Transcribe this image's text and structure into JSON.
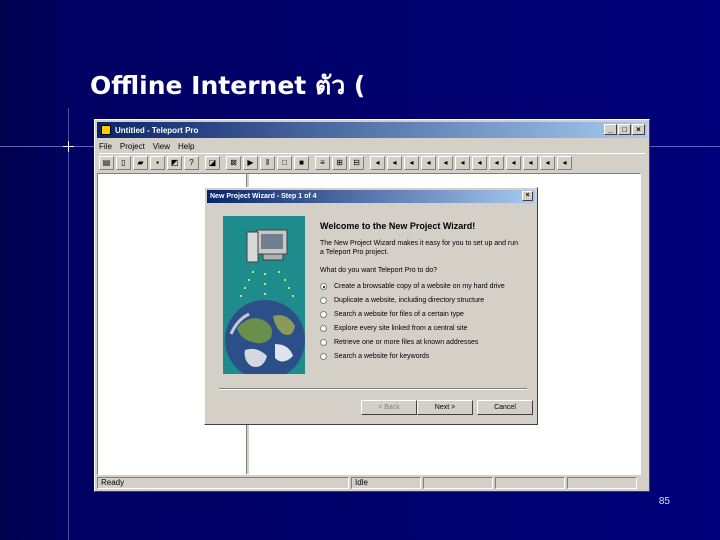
{
  "slide": {
    "title": "Offline Internet",
    "title_suffix": "ตัว (",
    "page_number": "85"
  },
  "app": {
    "title": "Untitled - Teleport Pro",
    "window_buttons": [
      "_",
      "□",
      "×"
    ],
    "menu": [
      "File",
      "Project",
      "View",
      "Help"
    ],
    "status_ready": "Ready",
    "status_idle": "Idle"
  },
  "wizard": {
    "title": "New Project Wizard - Step 1 of 4",
    "close": "×",
    "heading": "Welcome to the New Project Wizard!",
    "description": "The New Project Wizard makes it easy for you to set up and run a Teleport Pro project.",
    "question": "What do you want Teleport Pro to do?",
    "options": [
      "Create a browsable copy of a website on my hard drive",
      "Duplicate a website, including directory structure",
      "Search a website for files of a certain type",
      "Explore every site linked from a central site",
      "Retrieve one or more files at known addresses",
      "Search a website for keywords"
    ],
    "selected_option": 0,
    "back_label": "< Back",
    "next_label": "Next >",
    "cancel_label": "Cancel"
  },
  "colors": {
    "slide_bg": "#000066",
    "titlebar_start": "#0a246a",
    "titlebar_end": "#a6caf0",
    "window_face": "#d4d0c8",
    "wizard_image_bg": "#1e8c8c"
  }
}
